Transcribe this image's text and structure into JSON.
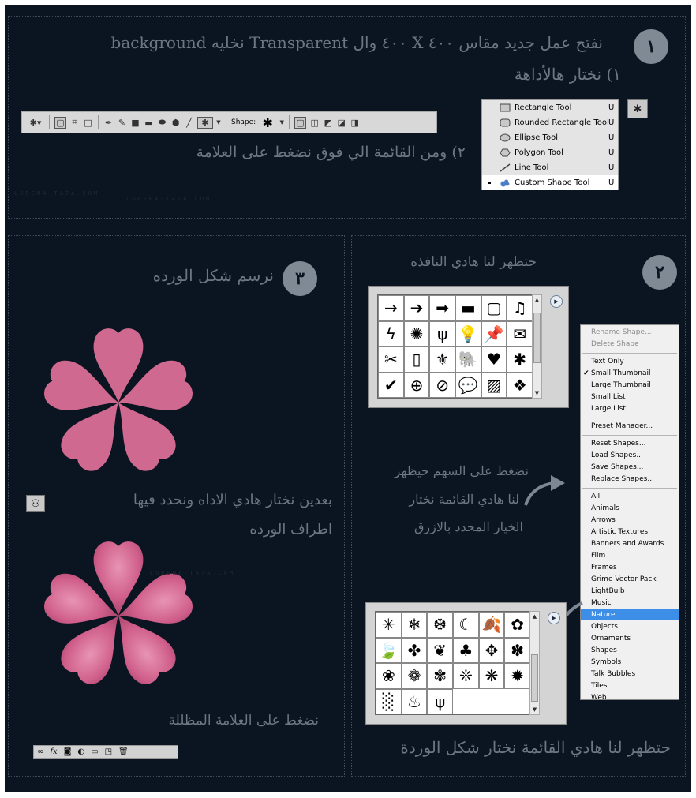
{
  "step1": {
    "number": "١",
    "line1": "نفتح عمل جديد مقاس ٤٠٠ X ٤٠٠ وال Transparent نخليه background",
    "line2": "١) نختار هالأداهة",
    "instruction2": "٢) ومن القائمة الي فوق نضغط على العلامة"
  },
  "step2": {
    "number": "٢",
    "window_caption": "حتظهر لنا هادي النافذه",
    "arrow_caption_line1": "نضغط على السهم حيظهر",
    "arrow_caption_line2": "لنا هادي القائمة نختار",
    "arrow_caption_line3": "الخيار المحدد بالازرق",
    "bottom_caption": "حتظهر لنا هادي القائمة نختار شكل الوردة"
  },
  "step3": {
    "number": "٣",
    "caption": "نرسم شكل الورده",
    "tool_caption_line1": "بعدين نختار هادي الاداه ونحدد فيها",
    "tool_caption_line2": "اطراف الورده",
    "shadow_caption": "نضغط على العلامة المظللة"
  },
  "watermark": "LORENA-TA7A.COM",
  "options_bar": {
    "shape_label": "Shape:"
  },
  "tool_flyout": {
    "items": [
      {
        "label": "Rectangle Tool",
        "key": "U",
        "icon": "rectangle-icon"
      },
      {
        "label": "Rounded Rectangle Tool",
        "key": "U",
        "icon": "rounded-rectangle-icon"
      },
      {
        "label": "Ellipse Tool",
        "key": "U",
        "icon": "ellipse-icon"
      },
      {
        "label": "Polygon Tool",
        "key": "U",
        "icon": "polygon-icon"
      },
      {
        "label": "Line Tool",
        "key": "U",
        "icon": "line-icon"
      },
      {
        "label": "Custom Shape Tool",
        "key": "U",
        "icon": "custom-shape-icon",
        "active": true
      }
    ]
  },
  "preset_menu": {
    "group1": [
      "Rename Shape...",
      "Delete Shape"
    ],
    "group2": [
      "Text Only",
      "Small Thumbnail",
      "Large Thumbnail",
      "Small List",
      "Large List"
    ],
    "checked": "Small Thumbnail",
    "group3": [
      "Preset Manager..."
    ],
    "group4": [
      "Reset Shapes...",
      "Load Shapes...",
      "Save Shapes...",
      "Replace Shapes..."
    ],
    "group5": [
      "All",
      "Animals",
      "Arrows",
      "Artistic Textures",
      "Banners and Awards",
      "Film",
      "Frames",
      "Grime Vector Pack",
      "LightBulb",
      "Music",
      "Nature",
      "Objects",
      "Ornaments",
      "Shapes",
      "Symbols",
      "Talk Bubbles",
      "Tiles",
      "Web"
    ],
    "highlighted": "Nature"
  },
  "shapes_default": [
    "→",
    "➔",
    "➡",
    "▬",
    "▢",
    "♫",
    "ϟ",
    "✺",
    "ψ",
    "💡",
    "📌",
    "✉",
    "✂",
    "▯",
    "⚜",
    "🐘",
    "♥",
    "✱",
    "✔",
    "⊕",
    "⊘",
    "💬",
    "▨",
    "❖"
  ],
  "shapes_nature": [
    "✳",
    "❄",
    "❆",
    "☾",
    "🍂",
    "✿",
    "🍃",
    "✤",
    "❦",
    "♣",
    "✥",
    "✽",
    "❀",
    "❁",
    "✾",
    "❊",
    "❋",
    "✹",
    "░",
    "♨",
    "ψ"
  ],
  "colors": {
    "background": "#0b1521",
    "heading": "#6d7784",
    "badge": "#7f8a94",
    "flower": "#d06990",
    "highlight": "#3d8ee6"
  }
}
